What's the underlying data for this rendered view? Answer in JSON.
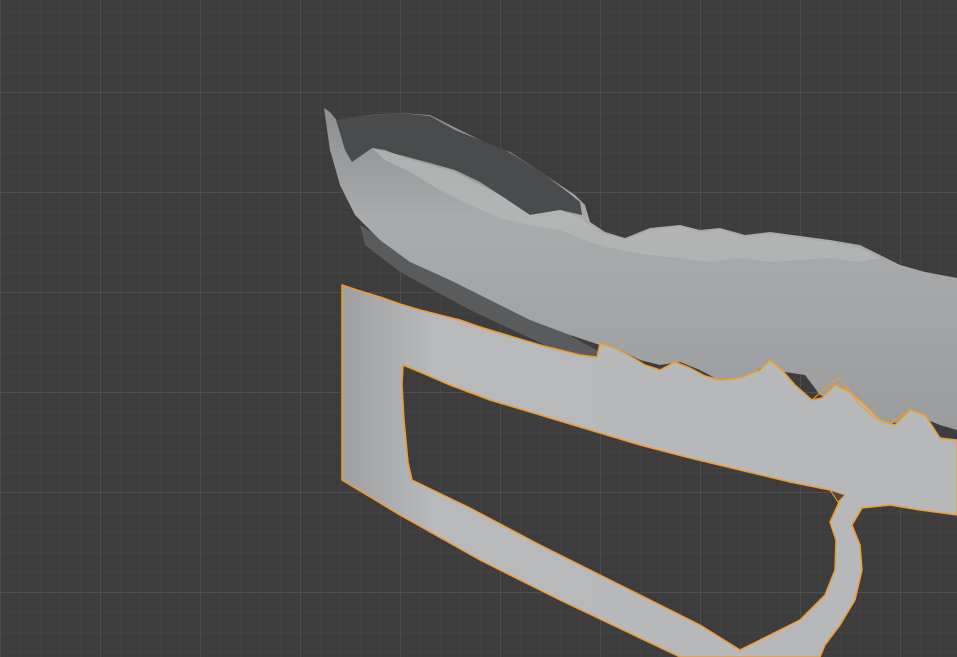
{
  "viewport": {
    "name": "3D Viewport",
    "background_color": "#3d3d3d",
    "grid_color": "#505050",
    "grid_minor_color": "#464646"
  },
  "objects": [
    {
      "id": "mesh-top",
      "label": "",
      "color": "#a7a9aa",
      "selected": false
    },
    {
      "id": "mesh-frame",
      "label": "",
      "color": "#b7b9ba",
      "selected": true,
      "outline_color": "#f29b2c"
    }
  ]
}
